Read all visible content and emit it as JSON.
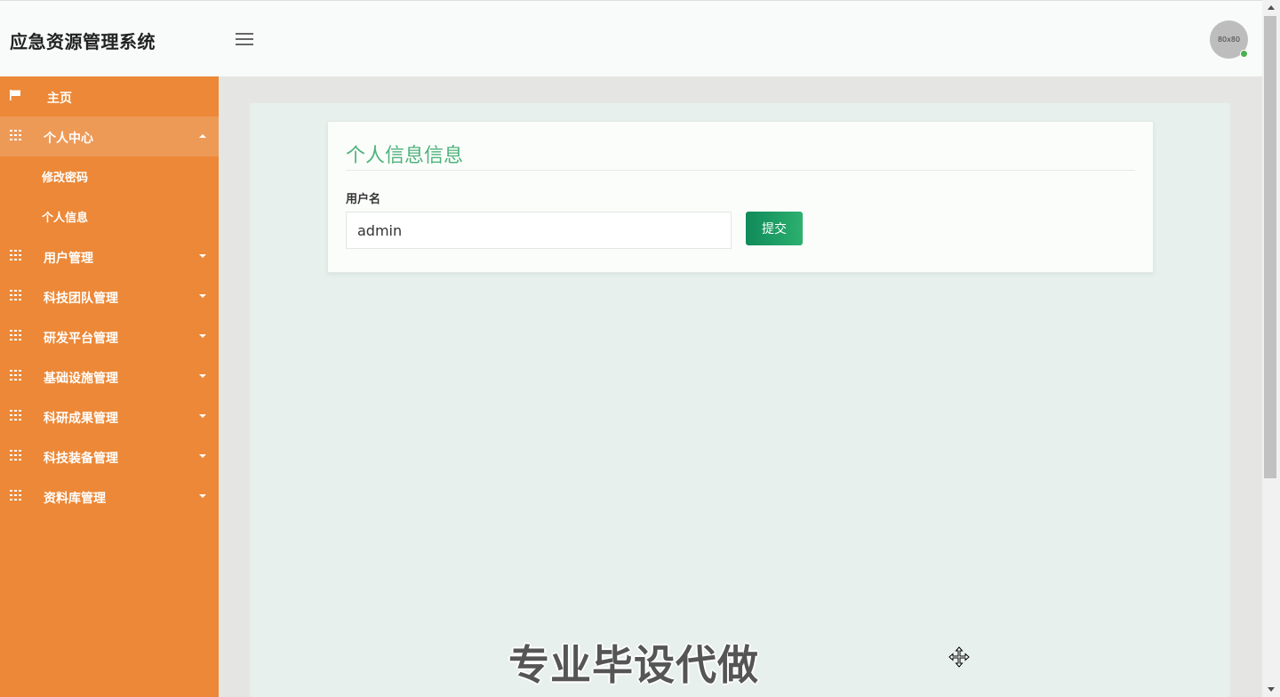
{
  "header": {
    "app_title": "应急资源管理系统",
    "menu_icon": "hamburger-icon",
    "avatar_text": "80x80"
  },
  "sidebar": {
    "home": {
      "label": "主页",
      "icon": "flag-icon"
    },
    "items": [
      {
        "label": "个人中心",
        "icon": "grid-icon",
        "expanded": true,
        "children": [
          {
            "label": "修改密码"
          },
          {
            "label": "个人信息"
          }
        ]
      },
      {
        "label": "用户管理",
        "icon": "grid-icon"
      },
      {
        "label": "科技团队管理",
        "icon": "grid-icon"
      },
      {
        "label": "研发平台管理",
        "icon": "grid-icon"
      },
      {
        "label": "基础设施管理",
        "icon": "grid-icon"
      },
      {
        "label": "科研成果管理",
        "icon": "grid-icon"
      },
      {
        "label": "科技装备管理",
        "icon": "grid-icon"
      },
      {
        "label": "资料库管理",
        "icon": "grid-icon"
      }
    ]
  },
  "form": {
    "title": "个人信息信息",
    "username_label": "用户名",
    "username_value": "admin",
    "submit_label": "提交"
  },
  "overlay": {
    "watermark": "专业毕设代做"
  },
  "colors": {
    "sidebar_bg": "#ec8837",
    "sidebar_active": "#ee9a57",
    "title_green": "#4fb27b",
    "button_green": "#1a9a62",
    "content_bg": "#e7f0ec"
  }
}
